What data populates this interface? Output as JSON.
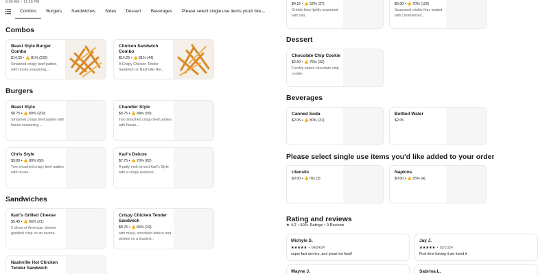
{
  "store": {
    "hours": "6:00 AM – 11:59 PM"
  },
  "nav": {
    "tabs": [
      "Combos",
      "Burgers",
      "Sandwiches",
      "Sides",
      "Dessert",
      "Beverages",
      "Please select single use items you'd like"
    ],
    "active_tab": "Combos",
    "prev_icon": "arrow-left-icon",
    "next_icon": "arrow-right-icon",
    "list_icon": "list-icon"
  },
  "sections": {
    "combos": "Combos",
    "burgers": "Burgers",
    "sandwiches": "Sandwiches",
    "dessert": "Dessert",
    "beverages": "Beverages",
    "single_use": "Please select single use items you'd like added to your order",
    "reviews": "Rating and reviews"
  },
  "items": {
    "top_left_side": {
      "price_meta": "$4.15 • 👍 52% (37)",
      "desc": "Crinkle fries lightly seasoned with salt."
    },
    "top_right_side": {
      "price_meta": "$6.00 • 👍 70% (116)",
      "desc": "Seasoned crinkle fries loaded with caramelized..."
    },
    "beast_combo": {
      "name": "Beast Style Burger Combo",
      "price_meta": "$14.25 • 👍 81% (232)",
      "desc": "Smashed crispy beef patties with house seasoning,..."
    },
    "chicken_combo": {
      "name": "Chicken Sandwich Combo",
      "price_meta": "$14.25 • 👍 81% (44)",
      "desc": "A Crispy Chicken Tender Sandwich or Nashville Hot..."
    },
    "beast_style": {
      "name": "Beast Style",
      "price_meta": "$8.75 • 👍 80% (202)",
      "desc": "Smashed crispy beef patties with house seasoning,..."
    },
    "chandler_style": {
      "name": "Chandler Style",
      "price_meta": "$8.75 • 👍 84% (59)",
      "desc": "Two smashed crispy beef patties with house..."
    },
    "chris_style": {
      "name": "Chris Style",
      "price_meta": "$9.80 • 👍 80% (60)",
      "desc": "Two smashed crispy beef patties with house..."
    },
    "karls_deluxe": {
      "name": "Karl's Deluxe",
      "price_meta": "$7.75 • 👍 70% (82)",
      "desc": "A patty melt served Karl's Style with a crispy seasone..."
    },
    "karls_grilled_cheese": {
      "name": "Karl's Grilled Cheese",
      "price_meta": "$5.45 • 👍 66% (21)",
      "desc": "3 slices of American cheese griddled crisp on an inverte..."
    },
    "crispy_chicken": {
      "name": "Crispy Chicken Tender Sandwich",
      "price_meta": "$8.75 • 👍 66% (24)",
      "desc": "with mayo, shredded lettuce and pickles on a toasted..."
    },
    "nashville_hot": {
      "name": "Nashville Hot Chicken Tender Sandwich",
      "price_meta": "",
      "desc": ""
    },
    "cookie": {
      "name": "Chocolate Chip Cookie",
      "price_meta": "$2.60 • 👍 75% (32)",
      "desc": "Freshly baked chocolate chip cookie."
    },
    "canned_soda": {
      "name": "Canned Soda",
      "price_meta": "$2.05 • 👍 80% (31)",
      "desc": ""
    },
    "bottled_water": {
      "name": "Bottled Water",
      "price_meta": "$2.05",
      "desc": ""
    },
    "utensils": {
      "name": "Utensils",
      "price_meta": "$0.00 • 👍 0% (3)",
      "desc": ""
    },
    "napkins": {
      "name": "Napkins",
      "price_meta": "$0.00 • 👍 25% (4)",
      "desc": ""
    }
  },
  "reviews_summary": {
    "rating": "4.2",
    "star_icon": "star-icon",
    "ratings_count": "500+ Ratings",
    "reviews_count": "9 Reviews"
  },
  "reviews": [
    {
      "name": "Michyle S.",
      "stars": "★★★★★",
      "date": "04/04/24",
      "text": "super fast service, and great hot food!"
    },
    {
      "name": "Jay J.",
      "stars": "★★★★★",
      "date": "02/11/24",
      "text": "First time having it we loved it"
    },
    {
      "name": "Wayne J.",
      "stars": "",
      "date": "",
      "text": ""
    },
    {
      "name": "Sabrina L.",
      "stars": "",
      "date": "",
      "text": ""
    }
  ],
  "colors": {
    "text": "#191919",
    "muted": "#606060",
    "border": "#e8e8e8",
    "thumb_bg": "#f6f6f6"
  }
}
